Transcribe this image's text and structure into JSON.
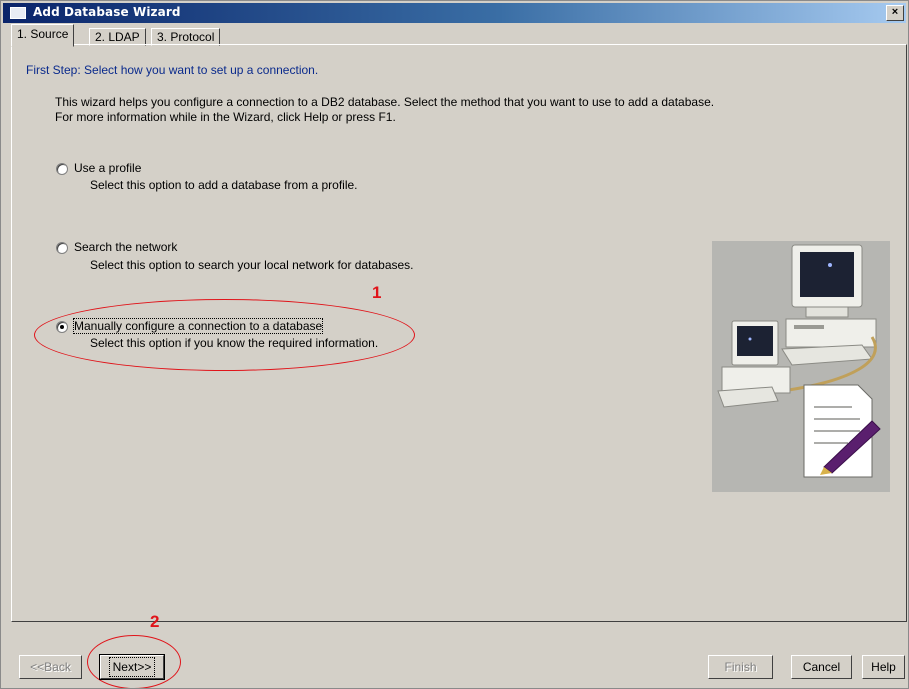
{
  "window": {
    "title": "Add Database Wizard",
    "close_label": "×"
  },
  "tabs": [
    {
      "label": "1. Source",
      "active": true
    },
    {
      "label": "2. LDAP",
      "active": false
    },
    {
      "label": "3. Protocol",
      "active": false
    }
  ],
  "step_title": "First Step: Select how you want to set up a connection.",
  "intro_text": "This wizard helps you configure a connection to a DB2 database.  Select the method that you want to use to add a database.  For more information while in the Wizard, click Help or press F1.",
  "options": [
    {
      "label": "Use a profile",
      "description": "Select this option to add a database from a profile.",
      "selected": false
    },
    {
      "label": "Search the network",
      "description": "Select this option to search your local network for databases.",
      "selected": false
    },
    {
      "label": "Manually configure a connection to a database",
      "description": "Select this option if you know the required information.",
      "selected": true
    }
  ],
  "annotations": {
    "first": "1",
    "second": "2",
    "color": "#e0141a"
  },
  "illustration": {
    "icon": "computer-network-document-icon"
  },
  "buttons": {
    "back": "<<Back",
    "next": "Next>>",
    "finish": "Finish",
    "cancel": "Cancel",
    "help": "Help"
  },
  "colors": {
    "title_bar": "#0a246a",
    "step_title": "#0a2a8c",
    "dialog_bg": "#d4d0c8"
  }
}
